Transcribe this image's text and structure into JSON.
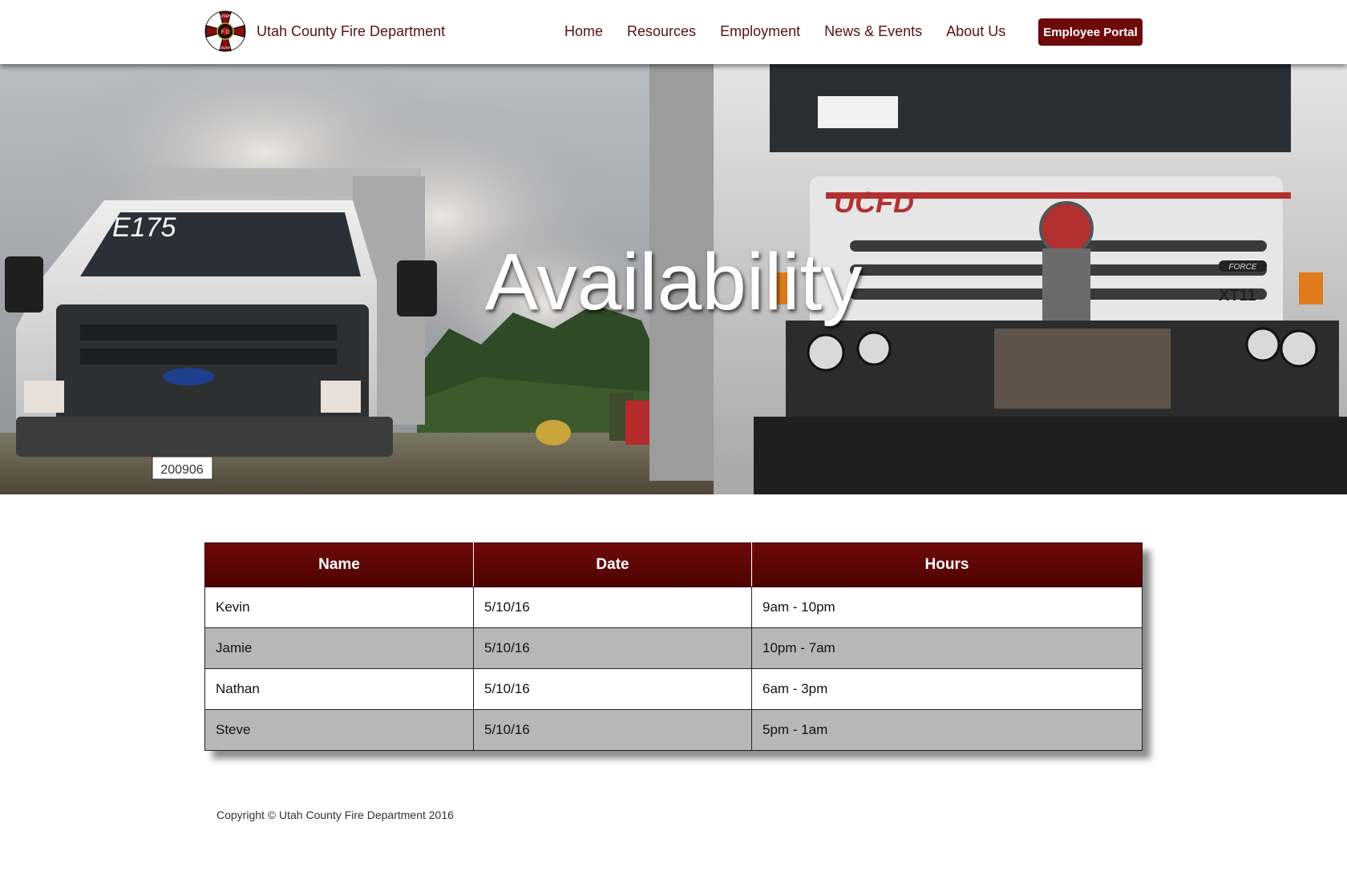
{
  "header": {
    "site_name": "Utah County Fire Department",
    "logo": {
      "icon": "maltese-cross-badge",
      "top_text": "UTAH",
      "bottom_text": "COUNTY",
      "center_text": "F D"
    },
    "nav": [
      {
        "label": "Home"
      },
      {
        "label": "Resources"
      },
      {
        "label": "Employment"
      },
      {
        "label": "News & Events"
      },
      {
        "label": "About Us"
      }
    ],
    "portal_button": "Employee Portal"
  },
  "hero": {
    "title": "Availability",
    "truck_left_label": "E175",
    "truck_left_plate": "200906",
    "truck_right_label": "UCFD",
    "truck_right_model": "XT11",
    "truck_right_badge": "FORCE"
  },
  "table": {
    "columns": [
      "Name",
      "Date",
      "Hours"
    ],
    "rows": [
      [
        "Kevin",
        "5/10/16",
        "9am - 10pm"
      ],
      [
        "Jamie",
        "5/10/16",
        "10pm - 7am"
      ],
      [
        "Nathan",
        "5/10/16",
        "6am - 3pm"
      ],
      [
        "Steve",
        "5/10/16",
        "5pm - 1am"
      ]
    ]
  },
  "footer": {
    "copyright": "Copyright © Utah County Fire Department 2016"
  },
  "colors": {
    "brand": "#6e0a0a",
    "nav_text": "#5a1111",
    "row_alt": "#b7b7b7"
  }
}
